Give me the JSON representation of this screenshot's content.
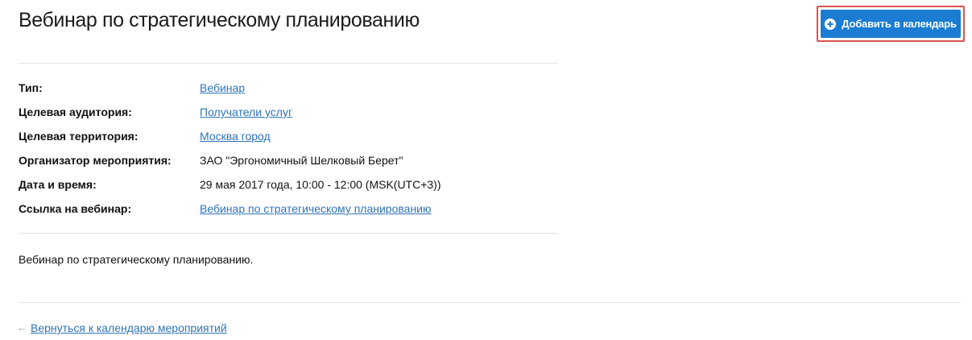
{
  "page": {
    "title": "Вебинар по стратегическому планированию"
  },
  "actions": {
    "add_to_calendar_label": "Добавить в календарь"
  },
  "details": [
    {
      "label": "Тип:",
      "value": "Вебинар",
      "is_link": true
    },
    {
      "label": "Целевая аудитория:",
      "value": "Получатели услуг",
      "is_link": true
    },
    {
      "label": "Целевая территория:",
      "value": "Москва город",
      "is_link": true
    },
    {
      "label": "Организатор мероприятия:",
      "value": "ЗАО \"Эргономичный Шелковый Берет\"",
      "is_link": false
    },
    {
      "label": "Дата и время:",
      "value": "29 мая 2017 года, 10:00 - 12:00 (MSK(UTC+3))",
      "is_link": false
    },
    {
      "label": "Ссылка на вебинар:",
      "value": "Вебинар по стратегическому планированию",
      "is_link": true
    }
  ],
  "description": "Вебинар по стратегическому планированию.",
  "footer": {
    "back_link_label": "Вернуться к календарю мероприятий",
    "back_icon": "arrow-left-icon"
  },
  "colors": {
    "button_bg": "#1a7cd2",
    "highlight_outline": "#d9534f",
    "link": "#2f73b9"
  }
}
